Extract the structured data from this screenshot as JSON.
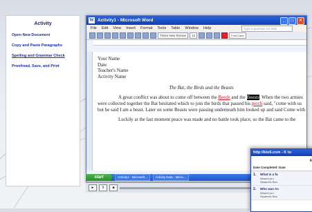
{
  "sidebar": {
    "title": "Activity",
    "items": [
      {
        "label": "Open New Document"
      },
      {
        "label": "Copy and Paste Paragraphs"
      },
      {
        "label": "Spelling and Grammar Check"
      },
      {
        "label": "Proofread, Save, and Print"
      }
    ]
  },
  "word": {
    "title": "Activity1 - Microsoft Word",
    "menus": [
      "File",
      "Edit",
      "View",
      "Insert",
      "Format",
      "Tools",
      "Table",
      "Window",
      "Help"
    ],
    "ask_placeholder": "Type a question for help",
    "font_name": "Times New Roman",
    "font_size": "12",
    "header_lines": [
      "Your Name",
      "Date",
      "Teacher's Name",
      "Activity Name"
    ],
    "story_title": "The Bat, the Birds and the Beasts",
    "para1_pre": "A great conflict was about to come off between the ",
    "para1_sp1": "Beeds",
    "para1_mid": " and the ",
    "para1_hl": "Beests",
    "para1_post": ". When the two armies were collected together the Bat hesitated which to join the birds that passed his ",
    "para1_sp2": "perch",
    "para1_post2": " said, \"come with us but he said I am a beast. Later on some Beasts were passing underneath him looked up and said Come with",
    "para2": "Luckily at the last moment peace was made and no battle took place, so the Bat came to the",
    "status": {
      "page": "Page 1",
      "sec": "Sec 1",
      "pos": "1/1",
      "at": "At 2.3\"",
      "ln": "Ln 8",
      "col": "Col 67",
      "rec": "REC",
      "trk": "TRK"
    },
    "font_color_tooltip": "Font Color"
  },
  "taskbar": {
    "start": "start",
    "tasks": [
      "Activity1 - Microsoft...",
      "Activity Data - Micro..."
    ]
  },
  "browser": {
    "title": "http://kto5.com - K to",
    "heading": "Acti",
    "date_label": "Date Completed: Date",
    "questions": [
      {
        "num": "1.",
        "text": "What is a fa",
        "sub1": "Wound yo r",
        "sub2": "Student's Res"
      },
      {
        "num": "2.",
        "text": "Who was As",
        "sub1": "Wound yo r",
        "sub2": "Student's Res"
      }
    ]
  }
}
